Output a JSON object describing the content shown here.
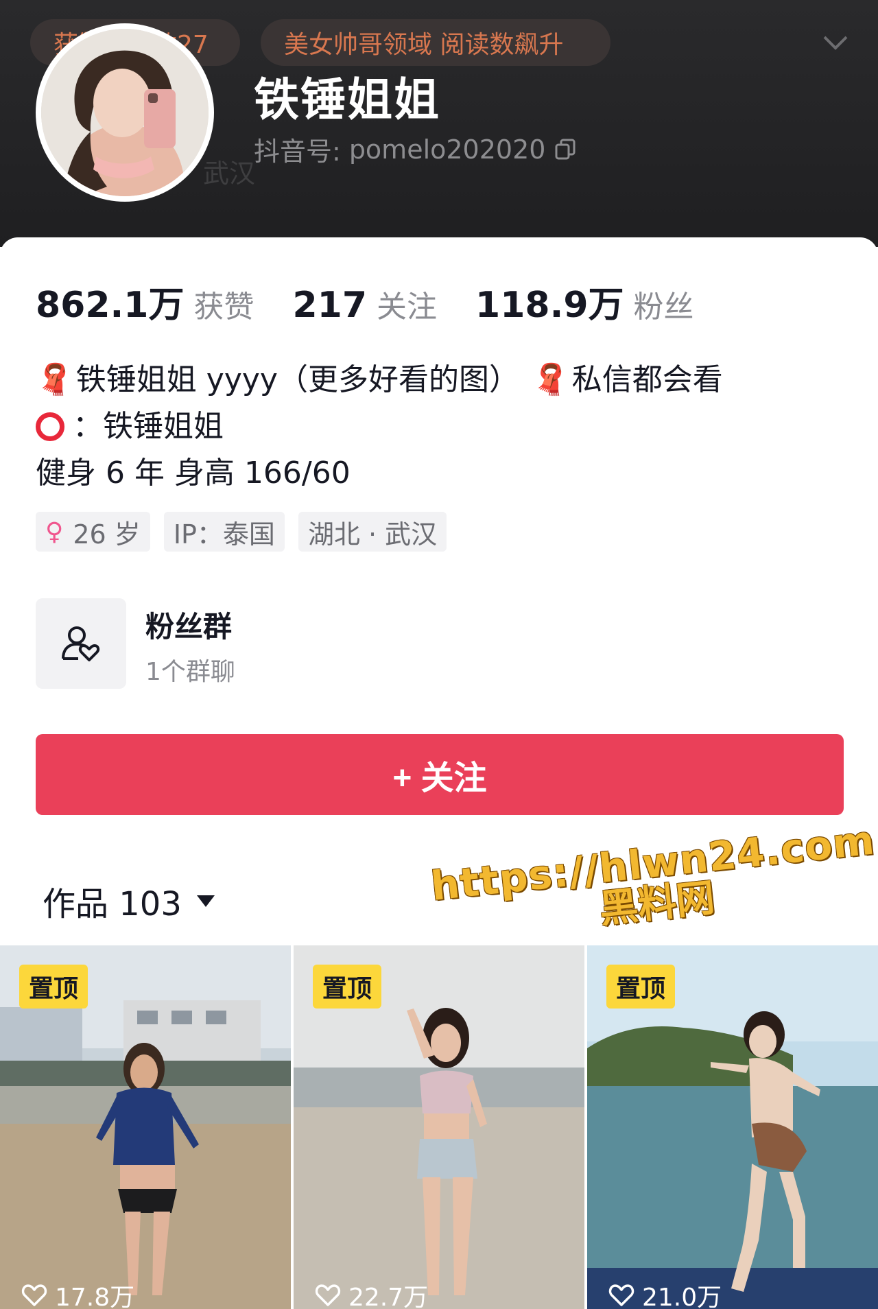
{
  "header": {
    "chips": [
      "获赞超过数27",
      "美女帅哥领域 阅读数飙升"
    ],
    "ghost_location": "武汉",
    "nickname": "铁锤姐姐",
    "account_label": "抖音号:",
    "account_id": "pomelo202020"
  },
  "stats": [
    {
      "value": "862.1万",
      "label": "获赞"
    },
    {
      "value": "217",
      "label": "关注"
    },
    {
      "value": "118.9万",
      "label": "粉丝"
    }
  ],
  "bio": {
    "line1_a": "铁锤姐姐 yyyy（更多好看的图）",
    "line1_b": "私信都会看",
    "line2": "：铁锤姐姐",
    "line3": "健身 6 年 身高 166/60"
  },
  "tags": {
    "age": "26 岁",
    "ip": "IP：泰国",
    "location": "湖北 · 武汉"
  },
  "fan_group": {
    "title": "粉丝群",
    "subtitle": "1个群聊"
  },
  "follow_button": "+ 关注",
  "works_tab": "作品 103",
  "watermark": {
    "url": "https://hlwn24.com",
    "name": "黑料网"
  },
  "videos": [
    {
      "pin": "置顶",
      "likes": "17.8万"
    },
    {
      "pin": "置顶",
      "likes": "22.7万"
    },
    {
      "pin": "置顶",
      "likes": "21.0万"
    }
  ],
  "colors": {
    "accent_red": "#ea4059",
    "pin_yellow": "#fcd73b",
    "header_bg": "#242426",
    "chip_text": "#d8774f"
  }
}
